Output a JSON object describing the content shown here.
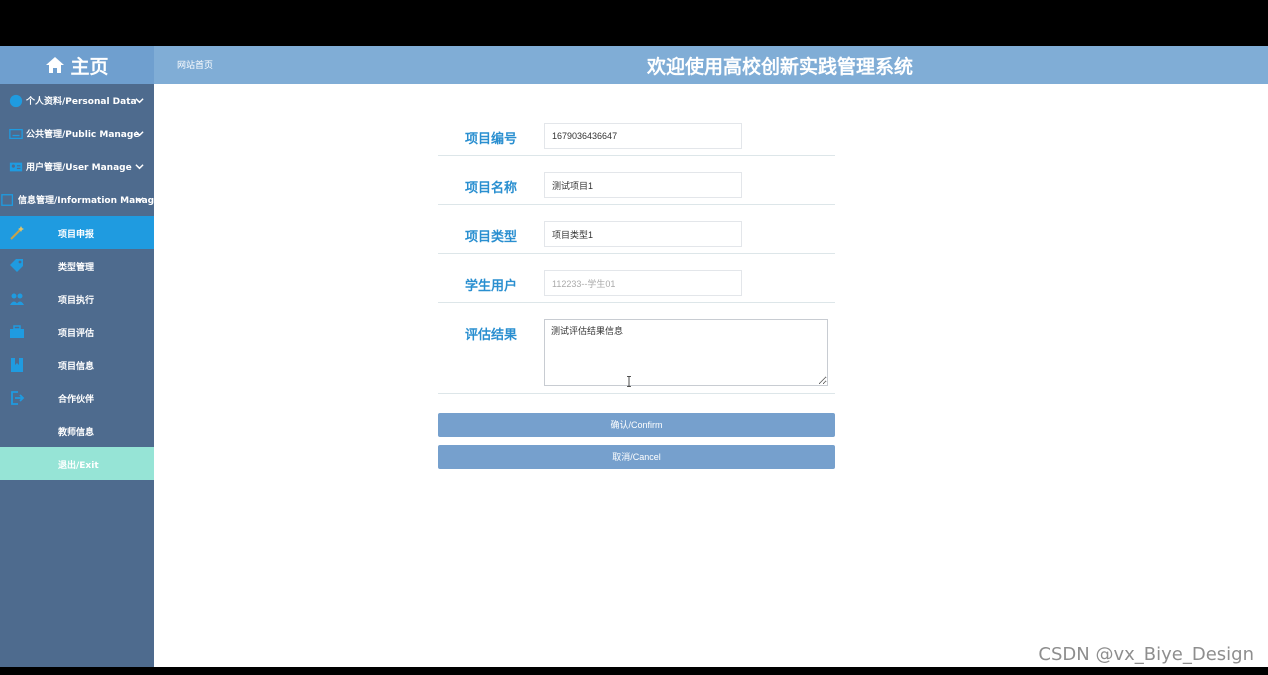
{
  "header": {
    "home_label": "主页",
    "site_link": "网站首页",
    "title": "欢迎使用高校创新实践管理系统"
  },
  "sidebar": {
    "groups": [
      {
        "label": "个人资料/Personal Data",
        "icon": "user-circle-icon"
      },
      {
        "label": "公共管理/Public Manage",
        "icon": "keyboard-icon"
      },
      {
        "label": "用户管理/User Manage",
        "icon": "id-card-icon"
      },
      {
        "label": "信息管理/Information Manage",
        "icon": "info-icon"
      }
    ],
    "items": [
      {
        "label": "项目申报",
        "icon": "wand-icon",
        "active": true
      },
      {
        "label": "类型管理",
        "icon": "tags-icon"
      },
      {
        "label": "项目执行",
        "icon": "users-icon"
      },
      {
        "label": "项目评估",
        "icon": "briefcase-icon"
      },
      {
        "label": "项目信息",
        "icon": "bookmark-icon"
      },
      {
        "label": "合作伙伴",
        "icon": "sign-out-icon"
      },
      {
        "label": "教师信息",
        "icon": ""
      }
    ],
    "exit_label": "退出/Exit"
  },
  "form": {
    "project_no": {
      "label": "项目编号",
      "value": "1679036436647"
    },
    "project_name": {
      "label": "项目名称",
      "value": "测试项目1"
    },
    "project_type": {
      "label": "项目类型",
      "value": "项目类型1"
    },
    "student_user": {
      "label": "学生用户",
      "value": "112233--学生01"
    },
    "eval_result": {
      "label": "评估结果",
      "value": "测试评估结果信息"
    }
  },
  "buttons": {
    "confirm": "确认/Confirm",
    "cancel": "取消/Cancel"
  },
  "watermark": "CSDN @vx_Biye_Design",
  "colors": {
    "topbar": "#80add6",
    "sidebar": "#4e6b8e",
    "active_item": "#1f9be0",
    "exit_item": "#96e4d6",
    "label": "#2a8fd0",
    "button": "#76a0cd"
  }
}
